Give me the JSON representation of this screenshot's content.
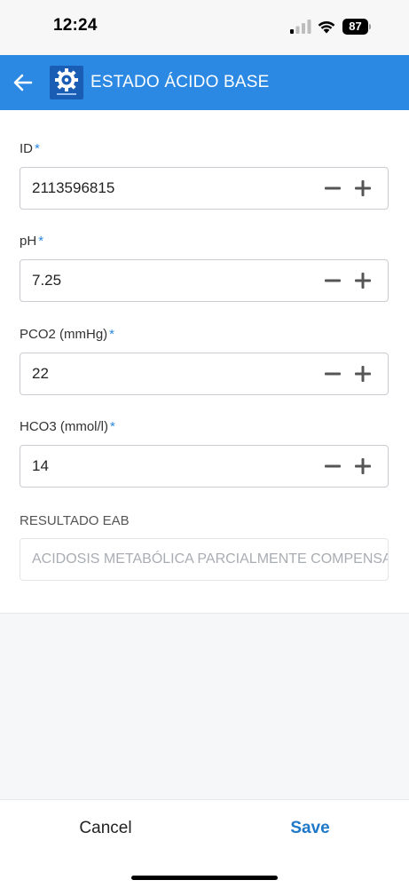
{
  "status_bar": {
    "time": "12:24",
    "battery_level": "87"
  },
  "app_bar": {
    "title": "ESTADO ÁCIDO BASE"
  },
  "form": {
    "fields": [
      {
        "label": "ID",
        "required_mark": "*",
        "value": "2113596815"
      },
      {
        "label": "pH",
        "required_mark": "*",
        "value": "7.25"
      },
      {
        "label": "PCO2 (mmHg)",
        "required_mark": "*",
        "value": "22"
      },
      {
        "label": "HCO3 (mmol/l)",
        "required_mark": "*",
        "value": "14"
      }
    ],
    "result": {
      "label": "RESULTADO EAB",
      "value": "ACIDOSIS METABÓLICA PARCIALMENTE COMPENSADA"
    }
  },
  "actions": {
    "cancel_label": "Cancel",
    "save_label": "Save"
  },
  "colors": {
    "accent": "#2b88e3",
    "save": "#1f78c8"
  }
}
